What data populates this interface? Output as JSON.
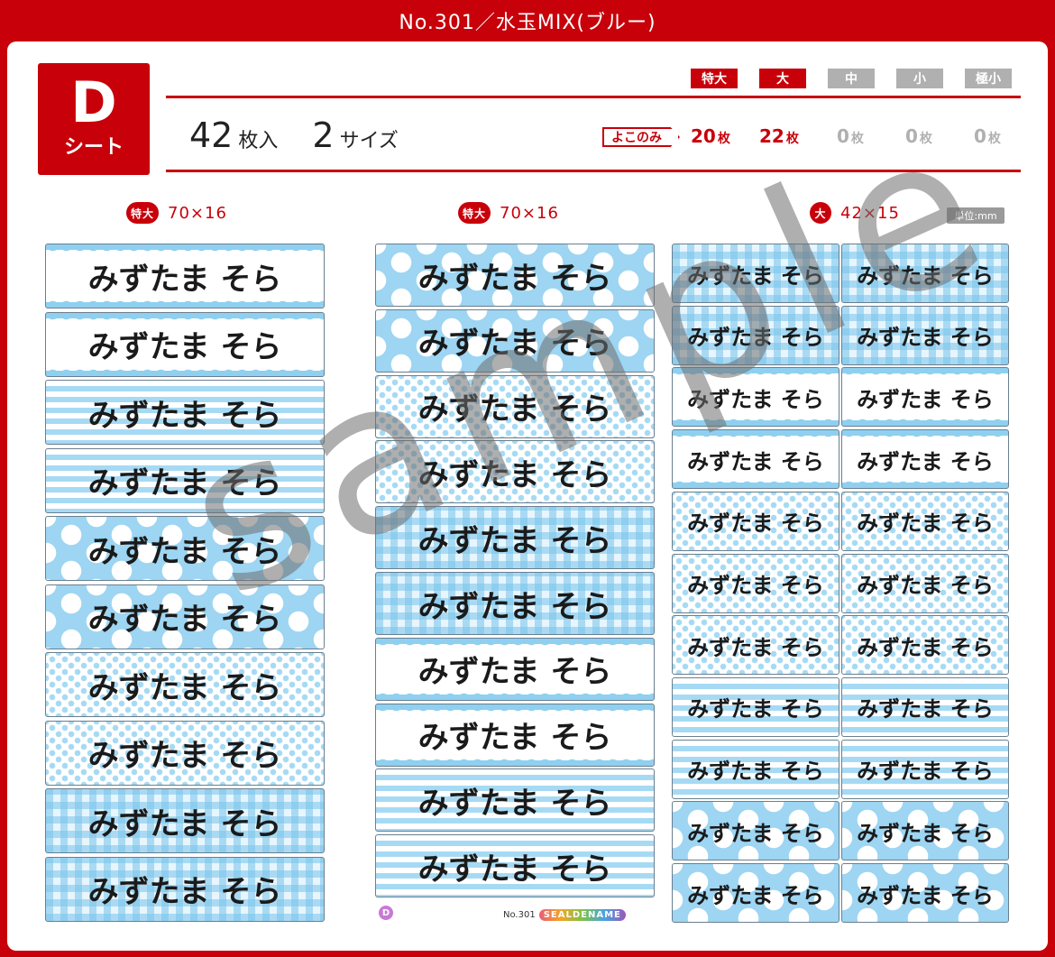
{
  "title": "No.301／水玉MIX(ブルー)",
  "sheet": {
    "letter": "D",
    "label": "シート"
  },
  "summary": {
    "count": "42",
    "count_unit": "枚入",
    "sizes": "2",
    "sizes_unit": "サイズ"
  },
  "size_tags": [
    {
      "label": "特大",
      "active": true
    },
    {
      "label": "大",
      "active": true
    },
    {
      "label": "中",
      "active": false
    },
    {
      "label": "小",
      "active": false
    },
    {
      "label": "極小",
      "active": false
    }
  ],
  "yoko_label": "よこのみ",
  "quantities": [
    {
      "num": "20",
      "unit": "枚",
      "active": true
    },
    {
      "num": "22",
      "unit": "枚",
      "active": true
    },
    {
      "num": "0",
      "unit": "枚",
      "active": false
    },
    {
      "num": "0",
      "unit": "枚",
      "active": false
    },
    {
      "num": "0",
      "unit": "枚",
      "active": false
    }
  ],
  "columns": [
    {
      "tag": "特大",
      "dims": "70×16"
    },
    {
      "tag": "特大",
      "dims": "70×16"
    },
    {
      "tag": "大",
      "dims": "42×15"
    }
  ],
  "unit_note": "単位:mm",
  "label_text": "みずたま そら",
  "watermark": "sample",
  "footer": {
    "letter": "D",
    "number": "No.301",
    "brand": "SEALDENAME"
  },
  "colors": {
    "brand_red": "#c8000a",
    "light_blue": "#9dd5f2",
    "inactive_gray": "#b0b0b0"
  }
}
